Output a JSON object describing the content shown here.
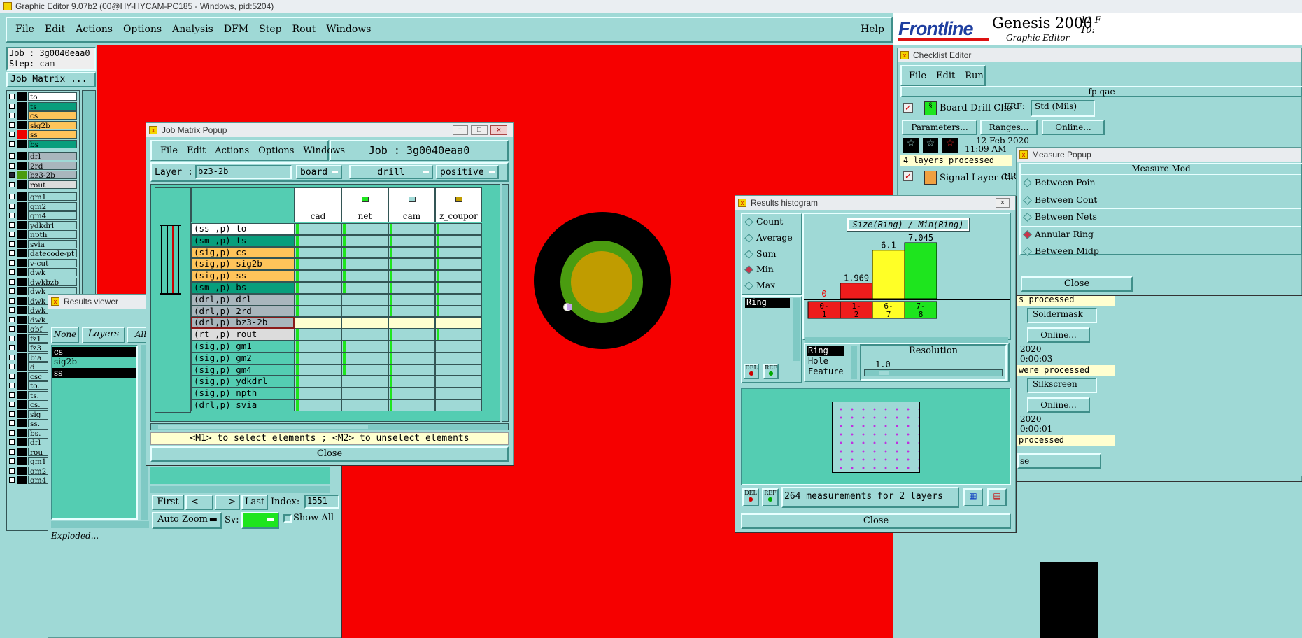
{
  "app_title": "Graphic Editor 9.07b2 (00@HY-HYCAM-PC185 - Windows, pid:5204)",
  "main_menu": [
    "File",
    "Edit",
    "Actions",
    "Options",
    "Analysis",
    "DFM",
    "Step",
    "Rout",
    "Windows"
  ],
  "help": "Help",
  "brand": {
    "logo": "Frontline",
    "product": "Genesis 2000",
    "subtitle": "Graphic Editor",
    "clock_top": "12 F",
    "clock_bottom": "10:"
  },
  "job_panel": {
    "job": "Job : 3g0040eaa0",
    "step": "Step: cam",
    "button": "Job Matrix ..."
  },
  "layers": [
    {
      "name": "to",
      "color": "#ffffff"
    },
    {
      "name": "ts",
      "color": "#089e7c"
    },
    {
      "name": "cs",
      "color": "#ffc45a"
    },
    {
      "name": "sig2b",
      "color": "#ffc45a"
    },
    {
      "name": "ss",
      "color": "#ffc45a"
    },
    {
      "name": "bs",
      "color": "#089e7c"
    },
    {
      "name": "drl",
      "color": "#a9b6bd"
    },
    {
      "name": "2rd",
      "color": "#a9b6bd"
    },
    {
      "name": "bz3-2b",
      "color": "#a9b6bd"
    },
    {
      "name": "rout",
      "color": "#dcdcdc"
    },
    {
      "name": "gm1",
      "color": "#9fd9d6"
    },
    {
      "name": "gm2",
      "color": "#9fd9d6"
    },
    {
      "name": "gm4",
      "color": "#9fd9d6"
    },
    {
      "name": "ydkdrl",
      "color": "#9fd9d6"
    },
    {
      "name": "npth",
      "color": "#9fd9d6"
    },
    {
      "name": "svia",
      "color": "#9fd9d6"
    },
    {
      "name": "datecode-pt",
      "color": "#9fd9d6"
    },
    {
      "name": "v-cut",
      "color": "#9fd9d6"
    },
    {
      "name": "dwk",
      "color": "#9fd9d6"
    },
    {
      "name": "dwkbzb",
      "color": "#9fd9d6"
    },
    {
      "name": "dwk",
      "color": "#9fd9d6"
    },
    {
      "name": "dwk",
      "color": "#9fd9d6"
    },
    {
      "name": "dwk",
      "color": "#9fd9d6"
    },
    {
      "name": "dwk",
      "color": "#9fd9d6"
    },
    {
      "name": "gbf",
      "color": "#9fd9d6"
    },
    {
      "name": "fz1",
      "color": "#9fd9d6"
    },
    {
      "name": "fz3",
      "color": "#9fd9d6"
    },
    {
      "name": "bia",
      "color": "#9fd9d6"
    },
    {
      "name": "d",
      "color": "#9fd9d6"
    },
    {
      "name": "csc",
      "color": "#9fd9d6"
    },
    {
      "name": "to.",
      "color": "#9fd9d6"
    },
    {
      "name": "ts.",
      "color": "#9fd9d6"
    },
    {
      "name": "cs.",
      "color": "#9fd9d6"
    },
    {
      "name": "sig",
      "color": "#9fd9d6"
    },
    {
      "name": "ss.",
      "color": "#9fd9d6"
    },
    {
      "name": "bs.",
      "color": "#9fd9d6"
    },
    {
      "name": "drl",
      "color": "#9fd9d6"
    },
    {
      "name": "rou",
      "color": "#9fd9d6"
    },
    {
      "name": "gm1",
      "color": "#9fd9d6"
    },
    {
      "name": "gm2",
      "color": "#9fd9d6"
    },
    {
      "name": "gm4",
      "color": "#9fd9d6"
    }
  ],
  "results_viewer": {
    "title": "Results viewer",
    "tabs": [
      "None",
      "Layers",
      "All"
    ],
    "items": [
      "cs",
      "sig2b",
      "ss"
    ],
    "nav": {
      "first": "First",
      "prev": "<---",
      "next": "--->",
      "last": "Last",
      "index_label": "Index:",
      "index_value": "1551"
    },
    "zoom": "Auto Zoom",
    "sv": "Sv:",
    "show_all": "Show All",
    "bottom_label": "Exploded..."
  },
  "job_matrix": {
    "title": "Job Matrix Popup",
    "menu": [
      "File",
      "Edit",
      "Actions",
      "Options",
      "Windows"
    ],
    "job": "Job : 3g0040eaa0",
    "layer_label": "Layer :",
    "layer_value": "bz3-2b",
    "context": "board",
    "type": "drill",
    "polarity": "positive",
    "columns": [
      "cad",
      "net",
      "cam",
      "z_coupor"
    ],
    "rows": [
      {
        "label": "(ss ,p) to",
        "color": "#ffffff"
      },
      {
        "label": "(sm ,p) ts",
        "color": "#089e7c"
      },
      {
        "label": "(sig,p) cs",
        "color": "#ffc45a"
      },
      {
        "label": "(sig,p) sig2b",
        "color": "#ffc45a"
      },
      {
        "label": "(sig,p) ss",
        "color": "#ffc45a"
      },
      {
        "label": "(sm ,p) bs",
        "color": "#089e7c"
      },
      {
        "label": "(drl,p) drl",
        "color": "#a9b6bd"
      },
      {
        "label": "(drl,p) 2rd",
        "color": "#a9b6bd"
      },
      {
        "label": "(drl,p) bz3-2b",
        "color": "#a9b6bd"
      },
      {
        "label": "(rt ,p) rout",
        "color": "#dcdcdc"
      },
      {
        "label": "(sig,p) gm1",
        "color": "#54cdb2"
      },
      {
        "label": "(sig,p) gm2",
        "color": "#54cdb2"
      },
      {
        "label": "(sig,p) gm4",
        "color": "#54cdb2"
      },
      {
        "label": "(sig,p) ydkdrl",
        "color": "#54cdb2"
      },
      {
        "label": "(sig,p) npth",
        "color": "#54cdb2"
      },
      {
        "label": "(drl,p) svia",
        "color": "#54cdb2"
      }
    ],
    "hint": "<M1> to select elements ; <M2> to unselect elements",
    "close": "Close"
  },
  "histogram": {
    "title": "Results histogram",
    "options": [
      "Count",
      "Average",
      "Sum",
      "Min",
      "Max"
    ],
    "selected": "Min",
    "chart_title": "Size(Ring) / Min(Ring)",
    "list_item": "Ring",
    "res_items": [
      "Ring",
      "Hole",
      "Feature"
    ],
    "resolution_label": "Resolution",
    "resolution_value": "1.0",
    "del": "DEL",
    "ref": "REF",
    "status": "264 measurements for 2 layers",
    "close": "Close"
  },
  "chart_data": {
    "type": "bar",
    "title": "Size(Ring) / Min(Ring)",
    "categories": [
      "0-1",
      "1-2",
      "6-7",
      "7-8"
    ],
    "values": [
      0,
      1.969,
      6.1,
      7.045
    ],
    "value_labels": [
      "0",
      "1.969",
      "6.1",
      "7.045"
    ],
    "colors": [
      "#ee1c1c",
      "#ee1c1c",
      "#ffff26",
      "#1ee51e"
    ],
    "ylim": [
      0,
      7.045
    ]
  },
  "checklist": {
    "title": "Checklist Editor",
    "menu": [
      "File",
      "Edit",
      "Run"
    ],
    "name": "fp-qae",
    "item1": "Board-Drill Che",
    "erf": "ERF:",
    "erf_value": "Std (Mils)",
    "buttons": [
      "Parameters...",
      "Ranges...",
      "Online..."
    ],
    "date": "12 Feb 2020",
    "time": "11:09 AM",
    "status1": "4 layers processed",
    "item2": "Signal Layer Ch",
    "er": "ER"
  },
  "measure": {
    "title": "Measure Popup",
    "header": "Measure Mod",
    "items": [
      "Between Poin",
      "Between Cont",
      "Between Nets",
      "Annular Ring",
      "Between Midp"
    ],
    "close": "Close"
  },
  "right_back": {
    "processed": "s processed",
    "soldermask": "Soldermask",
    "online": "Online...",
    "date1": "2020",
    "time1": "0:00:03",
    "were": "were processed",
    "silkscreen": "Silkscreen",
    "online2": "Online...",
    "date2": "2020",
    "time2": "0:00:01",
    "processed2": "processed",
    "dots": "...",
    "se": "se"
  }
}
